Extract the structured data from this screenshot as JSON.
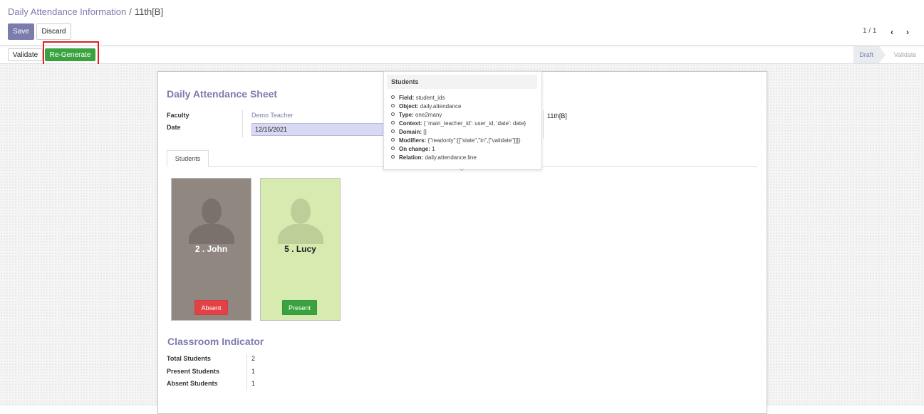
{
  "breadcrumb": {
    "parent": "Daily Attendance Information",
    "separator": "/",
    "current": "11th[B]"
  },
  "toolbar": {
    "save_label": "Save",
    "discard_label": "Discard",
    "pager_value": "1 / 1",
    "pager_prev_icon": "chevron-left-icon",
    "pager_next_icon": "chevron-right-icon"
  },
  "statusbar": {
    "validate_label": "Validate",
    "regenerate_label": "Re-Generate",
    "stages": [
      "Draft",
      "Validate"
    ],
    "active_stage": "Draft"
  },
  "form": {
    "title": "Daily Attendance Sheet",
    "faculty_label": "Faculty",
    "faculty_value": "Demo Teacher",
    "date_label": "Date",
    "date_value": "12/15/2021",
    "class_value": "11th[B]"
  },
  "tabs": [
    {
      "label": "Students"
    }
  ],
  "students": [
    {
      "name": "2 . John",
      "status": "Absent",
      "color": "#908781"
    },
    {
      "name": "5 . Lucy",
      "status": "Present",
      "color": "#d7ebb0"
    }
  ],
  "indicator": {
    "title": "Classroom Indicator",
    "rows": [
      {
        "label": "Total Students",
        "value": "2"
      },
      {
        "label": "Present Students",
        "value": "1"
      },
      {
        "label": "Absent Students",
        "value": "1"
      }
    ]
  },
  "tooltip": {
    "title": "Students",
    "items": [
      {
        "key": "Field:",
        "value": "student_ids"
      },
      {
        "key": "Object:",
        "value": "daily.attendance"
      },
      {
        "key": "Type:",
        "value": "one2many"
      },
      {
        "key": "Context:",
        "value": "{ 'main_teacher_id': user_id, 'date': date}"
      },
      {
        "key": "Domain:",
        "value": "[]"
      },
      {
        "key": "Modifiers:",
        "value": "{\"readonly\":[[\"state\",\"in\",[\"validate\"]]]}"
      },
      {
        "key": "On change:",
        "value": "1"
      },
      {
        "key": "Relation:",
        "value": "daily.attendance.line"
      }
    ]
  },
  "colors": {
    "brand": "#7c7bad",
    "success": "#3aa340",
    "danger": "#e24246",
    "highlight": "#e02020"
  }
}
